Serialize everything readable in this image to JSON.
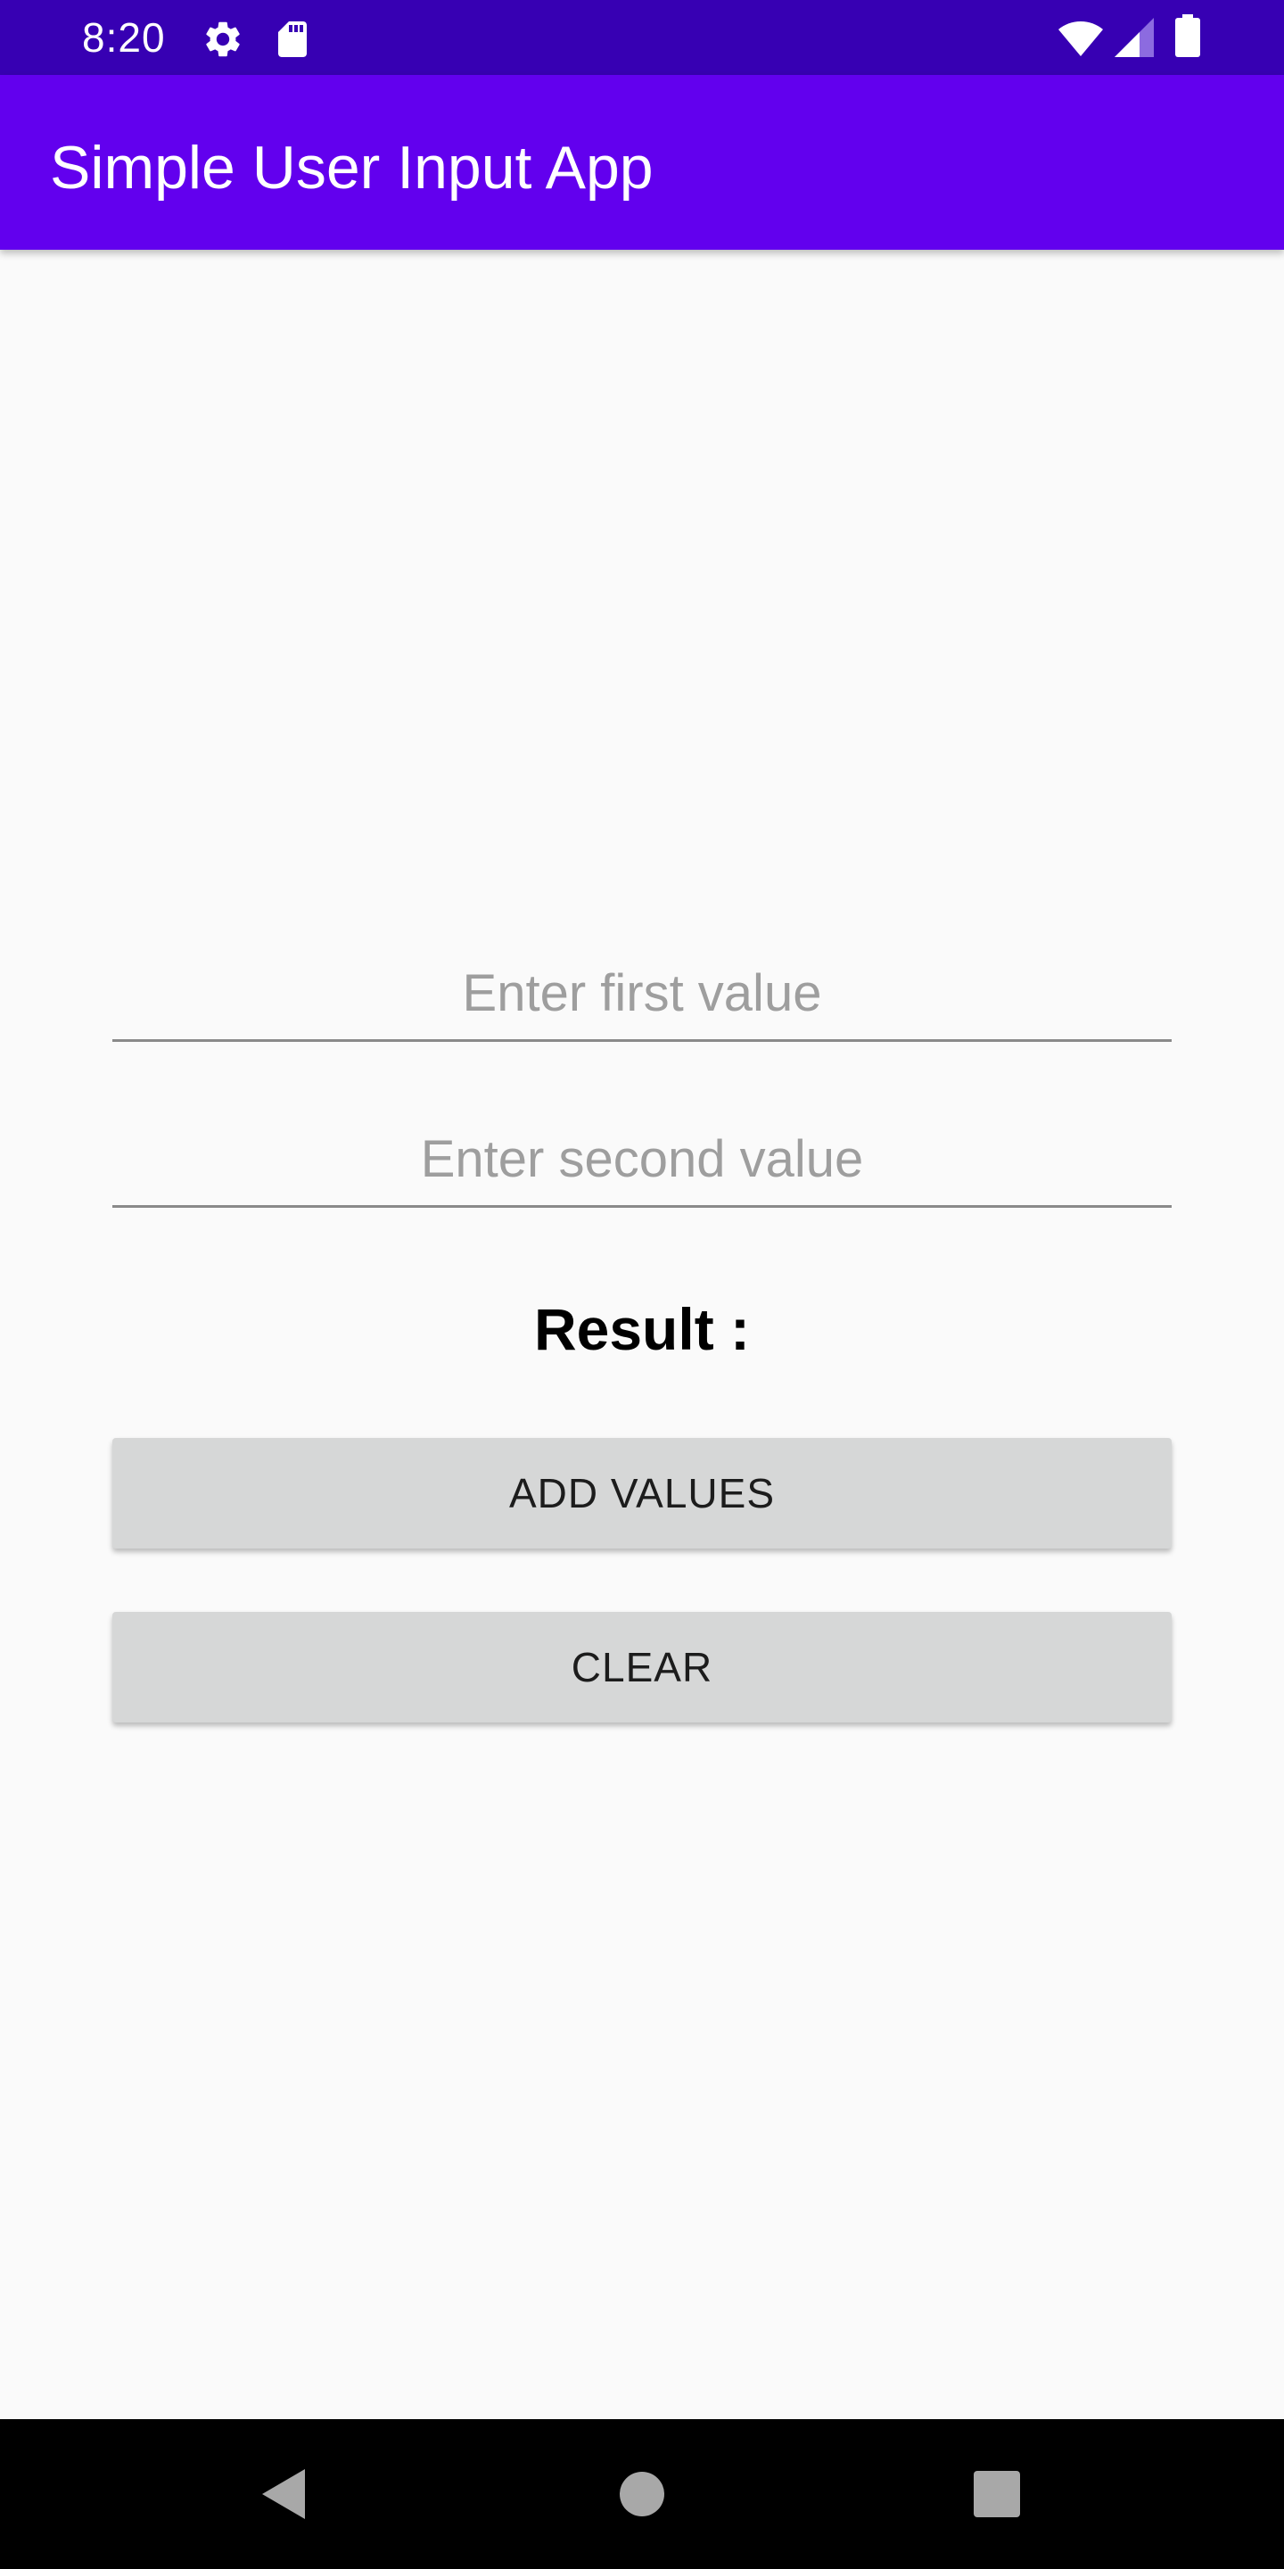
{
  "status_bar": {
    "time": "8:20",
    "icons": [
      "gear-icon",
      "sd-card-icon",
      "wifi-icon",
      "cell-signal-icon",
      "battery-icon"
    ],
    "background": "#3700b3"
  },
  "app_bar": {
    "title": "Simple User Input App",
    "background": "#6200ee"
  },
  "form": {
    "first_field": {
      "value": "",
      "placeholder": "Enter first value"
    },
    "second_field": {
      "value": "",
      "placeholder": "Enter second value"
    },
    "result_label": "Result :",
    "add_button_label": "ADD VALUES",
    "clear_button_label": "CLEAR",
    "button_color": "#d6d7d7"
  },
  "nav_bar": {
    "icons": [
      "back-icon",
      "home-icon",
      "recents-icon"
    ],
    "background": "#000000"
  }
}
